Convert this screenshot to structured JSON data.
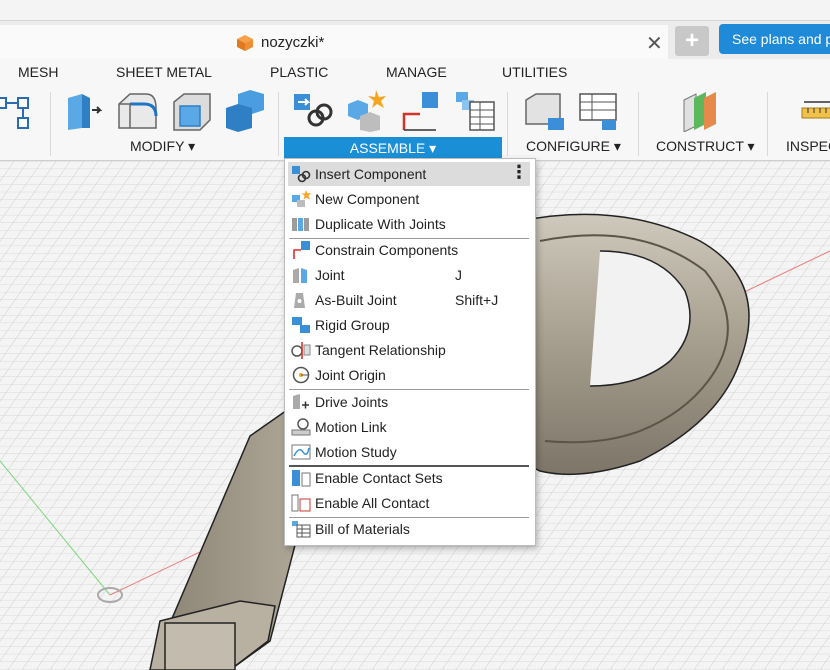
{
  "document": {
    "title": "nozyczki*"
  },
  "header": {
    "plans_label": "See plans and p",
    "new_tab_icon": "plus-icon"
  },
  "ribbon": {
    "tabs": [
      "MESH",
      "SHEET METAL",
      "PLASTIC",
      "MANAGE",
      "UTILITIES"
    ],
    "groups": {
      "modify": "MODIFY ▾",
      "assemble": "ASSEMBLE ▾",
      "configure": "CONFIGURE ▾",
      "construct": "CONSTRUCT ▾",
      "inspect": "INSPEC"
    },
    "accent": "#1b8fd6"
  },
  "menu": {
    "items": [
      {
        "label": "Insert Component",
        "icon": "insert-component-icon"
      },
      {
        "label": "New Component",
        "icon": "new-component-icon"
      },
      {
        "label": "Duplicate With Joints",
        "icon": "duplicate-joints-icon"
      },
      {
        "label": "Constrain Components",
        "icon": "constrain-icon"
      },
      {
        "label": "Joint",
        "shortcut": "J",
        "icon": "joint-icon"
      },
      {
        "label": "As-Built Joint",
        "shortcut": "Shift+J",
        "icon": "as-built-joint-icon"
      },
      {
        "label": "Rigid Group",
        "icon": "rigid-group-icon"
      },
      {
        "label": "Tangent Relationship",
        "icon": "tangent-icon"
      },
      {
        "label": "Joint Origin",
        "icon": "joint-origin-icon"
      },
      {
        "label": "Drive Joints",
        "icon": "drive-joints-icon"
      },
      {
        "label": "Motion Link",
        "icon": "motion-link-icon"
      },
      {
        "label": "Motion Study",
        "icon": "motion-study-icon"
      },
      {
        "label": "Enable Contact Sets",
        "icon": "contact-sets-icon"
      },
      {
        "label": "Enable All Contact",
        "icon": "all-contact-icon"
      },
      {
        "label": "Bill of Materials",
        "icon": "bom-icon"
      }
    ]
  }
}
